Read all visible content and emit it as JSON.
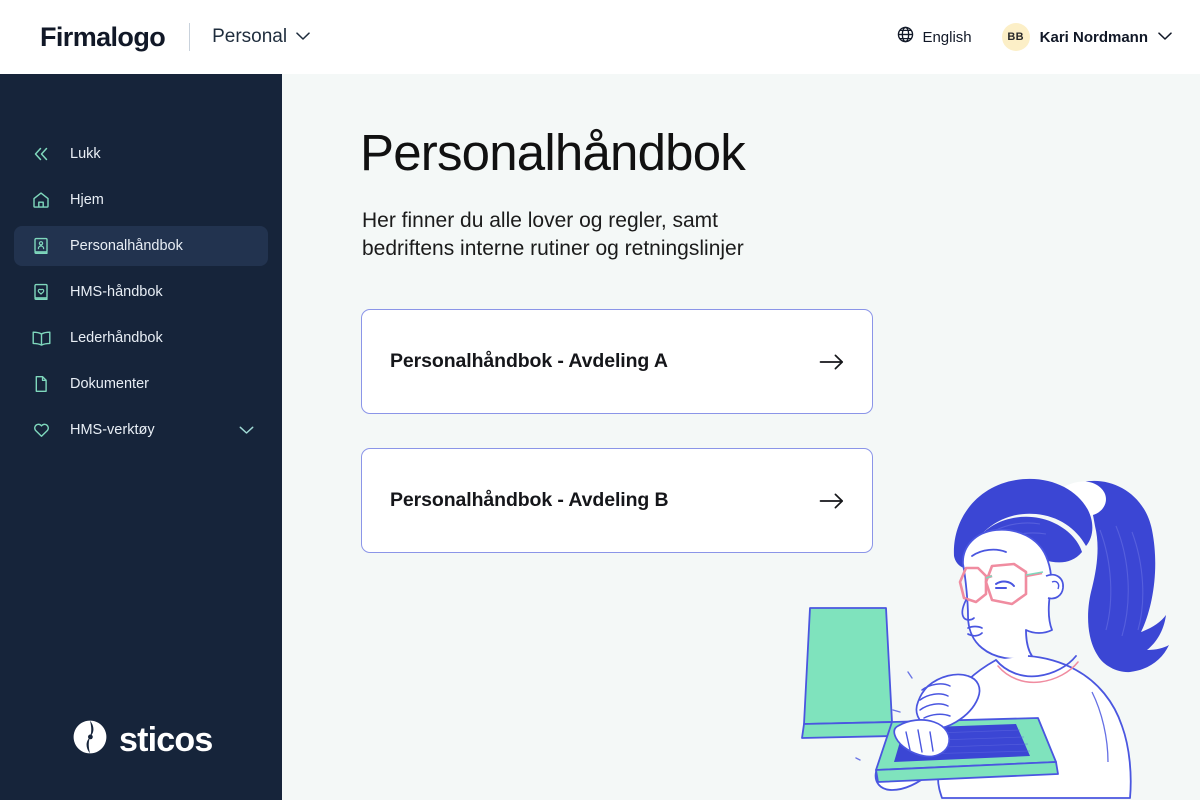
{
  "header": {
    "brand": "Firmalogo",
    "scope_label": "Personal",
    "scope_caret_icon": "chevron-down-icon",
    "language": {
      "icon": "globe-icon",
      "label": "English"
    },
    "user": {
      "initials": "BB",
      "name": "Kari Nordmann",
      "caret_icon": "chevron-down-icon",
      "avatar_bg": "#fcefc7"
    }
  },
  "sidebar": {
    "bg_color": "#16243a",
    "active_bg_color": "#22334f",
    "icon_color": "#7fd8bd",
    "items": [
      {
        "label": "Lukk",
        "icon": "chevrons-left-icon",
        "active": false,
        "expandable": false
      },
      {
        "label": "Hjem",
        "icon": "home-icon",
        "active": false,
        "expandable": false
      },
      {
        "label": "Personalhåndbok",
        "icon": "person-book-icon",
        "active": true,
        "expandable": false
      },
      {
        "label": "HMS-håndbok",
        "icon": "heart-book-icon",
        "active": false,
        "expandable": false
      },
      {
        "label": "Lederhåndbok",
        "icon": "open-book-icon",
        "active": false,
        "expandable": false
      },
      {
        "label": "Dokumenter",
        "icon": "document-icon",
        "active": false,
        "expandable": false
      },
      {
        "label": "HMS-verktøy",
        "icon": "heart-icon",
        "active": false,
        "expandable": true
      }
    ],
    "footer_logo": {
      "wordmark": "sticos",
      "mark_icon": "sticos-circle-icon"
    }
  },
  "main": {
    "title": "Personalhåndbok",
    "subtitle": "Her finner du alle lover og regler, samt\nbedriftens interne rutiner og retningslinjer",
    "cards": [
      {
        "title": "Personalhåndbok  -  Avdeling A",
        "arrow_icon": "arrow-right-icon"
      },
      {
        "title": "Personalhåndbok  -  Avdeling B",
        "arrow_icon": "arrow-right-icon"
      }
    ],
    "illustration": {
      "name": "woman-typing-on-laptop-illustration",
      "hair_color": "#3b46d4",
      "laptop_color": "#7fe3bd",
      "keyboard_color": "#3b46d4",
      "glasses_color": "#f08ca0",
      "outline_color": "#4a56e0"
    },
    "background_color": "#f4f8f7",
    "card_border_color": "#8b95e8"
  }
}
